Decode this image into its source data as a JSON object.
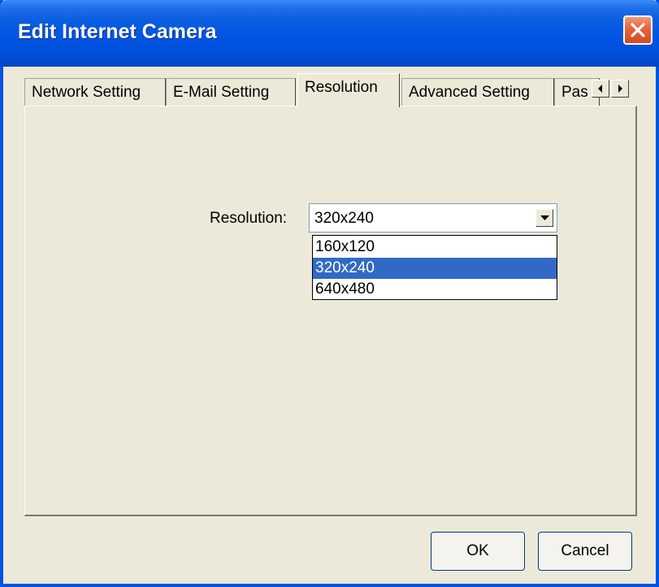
{
  "window": {
    "title": "Edit Internet Camera",
    "close_icon": "close-icon"
  },
  "tabs": [
    {
      "label": "Network Setting",
      "active": false
    },
    {
      "label": "E-Mail Setting",
      "active": false
    },
    {
      "label": "Resolution",
      "active": true
    },
    {
      "label": "Advanced Setting",
      "active": false
    },
    {
      "label": "Pas",
      "active": false
    }
  ],
  "tab_scroll": {
    "left_icon": "arrow-left-icon",
    "right_icon": "arrow-right-icon"
  },
  "resolution": {
    "label": "Resolution:",
    "value": "320x240",
    "options": [
      "160x120",
      "320x240",
      "640x480"
    ],
    "selected_index": 1
  },
  "buttons": {
    "ok": "OK",
    "cancel": "Cancel"
  },
  "colors": {
    "titlebar": "#0055e5",
    "selection": "#316ac5",
    "dialog_bg": "#ece9d8",
    "close_button": "#e8673e"
  }
}
